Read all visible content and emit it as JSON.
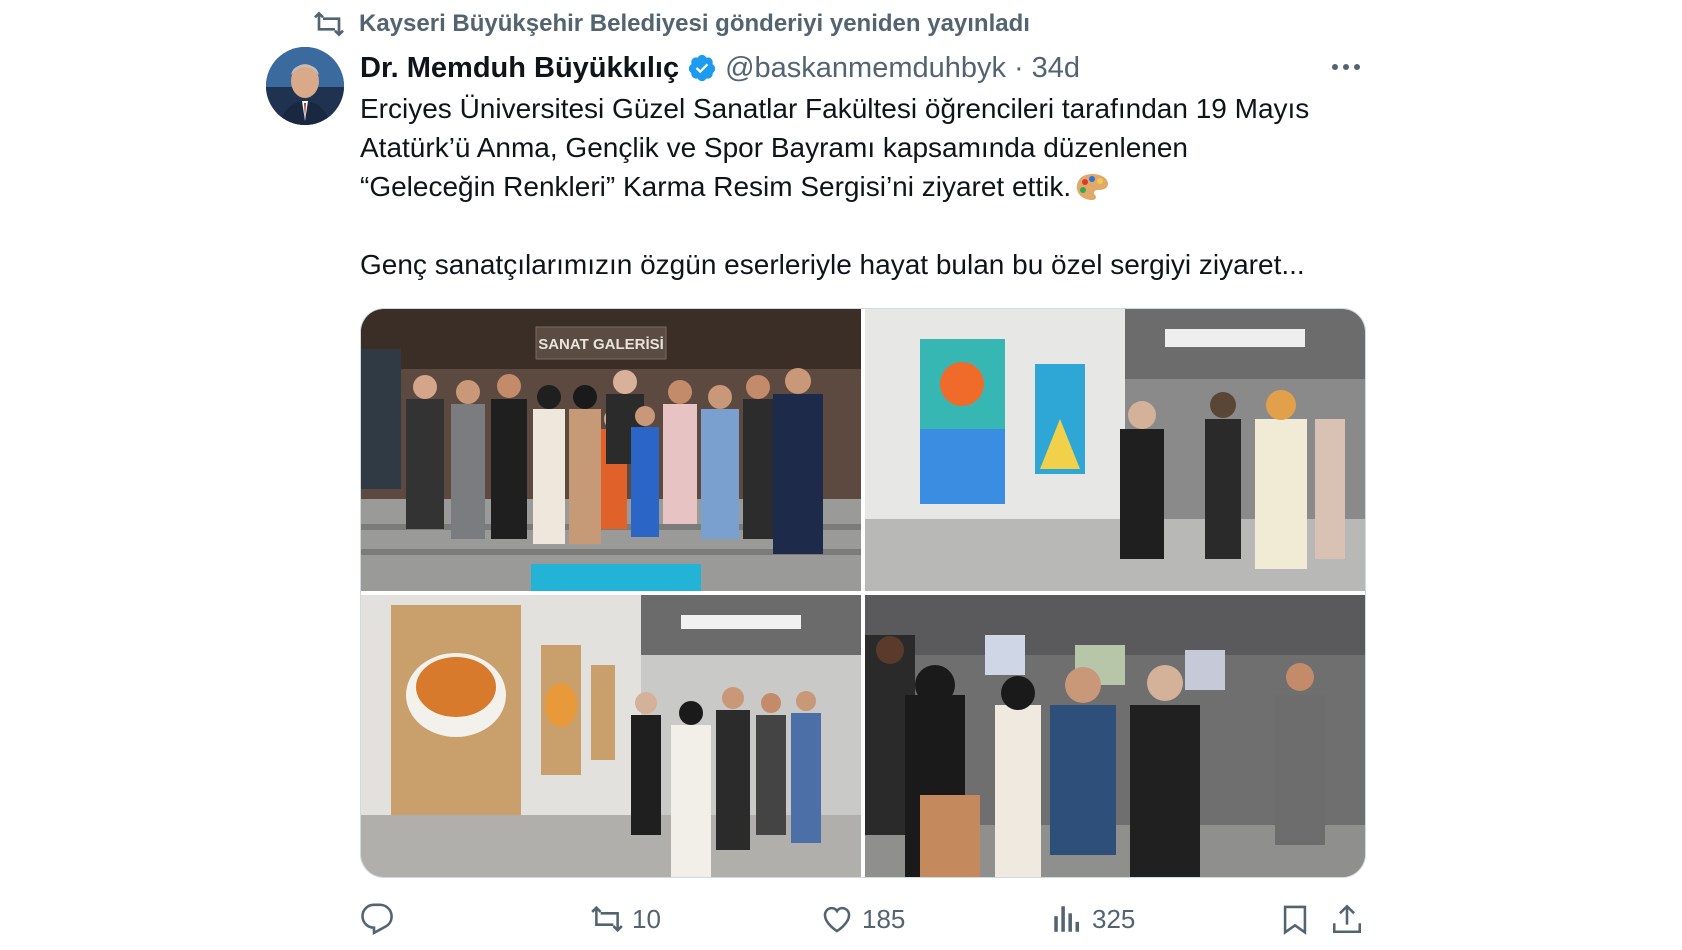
{
  "repost": {
    "icon": "repost-icon",
    "text": "Kayseri Büyükşehir Belediyesi gönderiyi yeniden yayınladı"
  },
  "author": {
    "name": "Dr. Memduh Büyükkılıç",
    "handle": "@baskanmemduhbyk",
    "separator": "·",
    "time": "34d",
    "verified_color": "#1d9bf0"
  },
  "post": {
    "lines": [
      "Erciyes Üniversitesi Güzel Sanatlar Fakültesi öğrencileri tarafından 19 Mayıs",
      "Atatürk’ü Anma, Gençlik ve Spor Bayramı kapsamında düzenlenen",
      "“Geleceğin Renkleri” Karma Resim Sergisi’ni ziyaret ettik."
    ],
    "emoji": "palette-emoji",
    "line4": "Genç sanatçılarımızın özgün eserleriyle hayat bulan bu özel sergiyi ziyaret..."
  },
  "media": {
    "photo1_sign": "SANAT GALERİSİ"
  },
  "actions": {
    "reply_icon": "reply-icon",
    "repost_count": "10",
    "like_count": "185",
    "views_count": "325",
    "bookmark_icon": "bookmark-icon",
    "share_icon": "share-icon"
  },
  "colors": {
    "text": "#0f1419",
    "muted": "#536471",
    "accent": "#1d9bf0"
  }
}
